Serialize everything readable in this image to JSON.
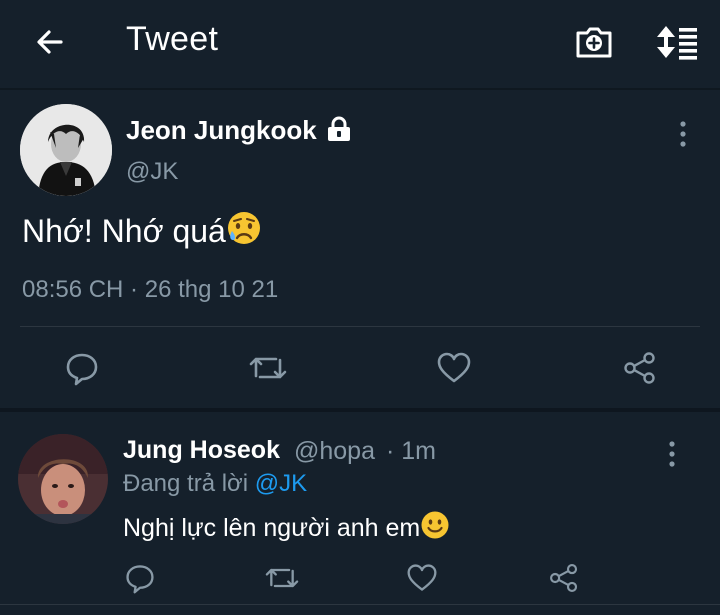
{
  "header": {
    "title": "Tweet"
  },
  "main_tweet": {
    "author_name": "Jeon Jungkook",
    "handle": "@JK",
    "text": "Nhớ! Nhớ quá",
    "timestamp": "08:56 CH · 26 thg 10 21"
  },
  "reply": {
    "author_name": "Jung Hoseok",
    "handle": "@hopa",
    "age": "· 1m",
    "replying_label": "Đang trả lời",
    "replying_to": "@JK",
    "text": "Nghị lực lên người anh em"
  },
  "icons": {
    "back": "arrow-left-icon",
    "camera": "camera-plus-icon",
    "sort": "sort-icon",
    "lock": "lock-icon",
    "more": "more-vertical-icon",
    "reply": "reply-icon",
    "retweet": "retweet-icon",
    "like": "heart-icon",
    "share": "share-icon",
    "sad_emoji": "sad-tear-emoji-icon",
    "smile_emoji": "smile-emoji-icon"
  },
  "colors": {
    "background": "#15202b",
    "muted": "#8899a6",
    "accent": "#1d9bf0"
  }
}
